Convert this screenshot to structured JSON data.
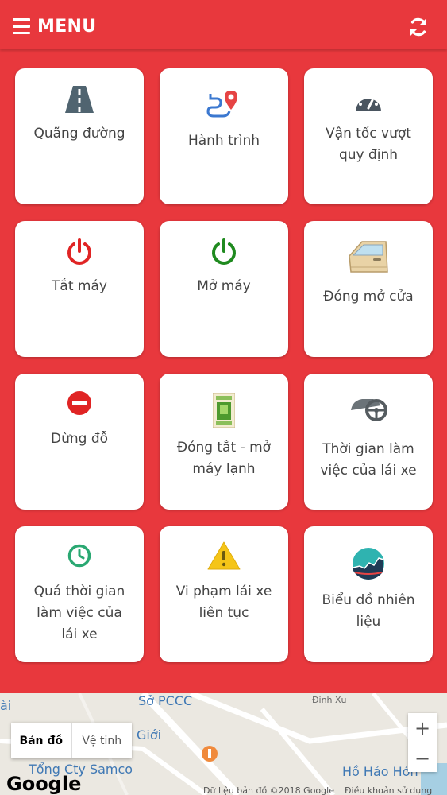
{
  "header": {
    "menu_label": "MENU",
    "color": "#e8383d"
  },
  "tiles": [
    {
      "label_lines": [
        "Quãng đường"
      ],
      "icon": "road-icon"
    },
    {
      "label_lines": [
        "Hành trình"
      ],
      "icon": "route-pin-icon"
    },
    {
      "label_lines": [
        "Vận tốc vượt",
        "quy định"
      ],
      "icon": "speedometer-icon"
    },
    {
      "label_lines": [
        "Tắt máy"
      ],
      "icon": "power-off-icon",
      "color": "#e02424"
    },
    {
      "label_lines": [
        "Mở máy"
      ],
      "icon": "power-on-icon",
      "color": "#1f8a1f"
    },
    {
      "label_lines": [
        "Đóng mở cửa"
      ],
      "icon": "car-door-icon"
    },
    {
      "label_lines": [
        "Dừng đỗ"
      ],
      "icon": "no-entry-icon",
      "color": "#e02424"
    },
    {
      "label_lines": [
        "Đóng tắt - mở",
        "máy lạnh"
      ],
      "icon": "ac-switch-icon"
    },
    {
      "label_lines": [
        "Thời gian làm",
        "việc của lái xe"
      ],
      "icon": "steering-wheel-icon"
    },
    {
      "label_lines": [
        "Quá thời gian",
        "làm việc của",
        "lái xe"
      ],
      "icon": "clock-icon",
      "color": "#2aa872"
    },
    {
      "label_lines": [
        "Vi phạm lái xe",
        "liên tục"
      ],
      "icon": "warning-icon",
      "color": "#f5c518"
    },
    {
      "label_lines": [
        "Biểu đồ nhiên",
        "liệu"
      ],
      "icon": "fuel-chart-icon"
    }
  ],
  "map": {
    "labels": {
      "pccc": "Sở PCCC",
      "dinh_xu": "Đinh Xu",
      "gioi": "Giới",
      "samco": "Tổng Cty Samco",
      "ho_hao_hon": "Hồ Hảo Hớn",
      "left_edge": "ài"
    },
    "type_map": "Bản đồ",
    "type_satellite": "Vệ tinh",
    "zoom_in": "+",
    "zoom_out": "−",
    "attribution": "Dữ liệu bản đồ ©2018 Google",
    "terms": "Điều khoản sử dụng",
    "google_logo": "Google"
  }
}
